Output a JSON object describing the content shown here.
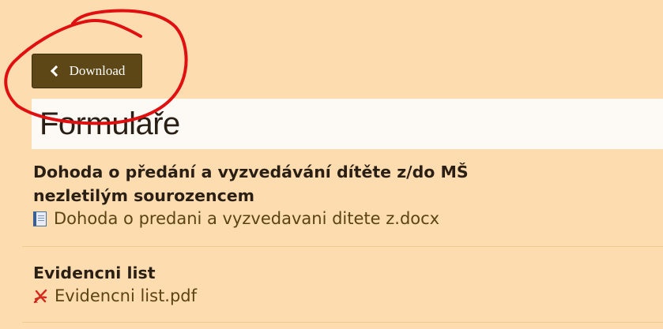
{
  "toolbar": {
    "back_label": "Download"
  },
  "page": {
    "title": "Formulaře"
  },
  "items": [
    {
      "title": "Dohoda o předání a vyzvedávání dítěte z/do MŠ nezletilým sourozencem",
      "file_name": "Dohoda o predani a vyzvedavani ditete z.docx",
      "file_icon": "word-document-icon"
    },
    {
      "title": "Evidencni list",
      "file_name": "Evidencni list.pdf",
      "file_icon": "pdf-file-icon"
    }
  ],
  "colors": {
    "background": "#fddcb0",
    "button": "#5d4716",
    "annotation": "#e01010",
    "link": "#5b4413"
  }
}
